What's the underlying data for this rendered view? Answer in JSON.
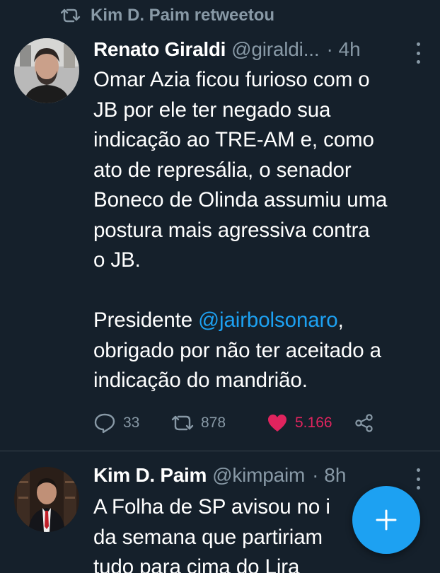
{
  "retweet_banner": {
    "text": "Kim D. Paim retweetou",
    "icon": "retweet-icon"
  },
  "tweets": [
    {
      "display_name": "Renato Giraldi",
      "handle": "@giraldi...",
      "time": "· 4h",
      "body_lines": [
        "Omar Azia ficou furioso com o",
        "JB por ele ter negado sua",
        "indicação ao TRE-AM e, como",
        "ato de represália, o senador",
        "Boneco de Olinda assumiu uma",
        "postura mais agressiva contra",
        "o JB."
      ],
      "body_lines_2": {
        "prefix": "Presidente ",
        "mention": "@jairbolsonaro",
        "suffix": ",",
        "line2": "obrigado por não ter aceitado a",
        "line3": "indicação do mandrião."
      },
      "actions": {
        "replies": "33",
        "retweets": "878",
        "likes": "5.166"
      }
    },
    {
      "display_name": "Kim D. Paim",
      "handle": "@kimpaim",
      "time": "· 8h",
      "body_lines": [
        "A Folha de SP avisou no i",
        "da semana que partiriam",
        "tudo para cima do Lira"
      ]
    }
  ],
  "colors": {
    "background": "#15202b",
    "secondary_text": "#8899a6",
    "accent": "#1da1f2",
    "like": "#e0245e",
    "divider": "#38444d"
  },
  "fab": {
    "icon": "plus-icon"
  }
}
